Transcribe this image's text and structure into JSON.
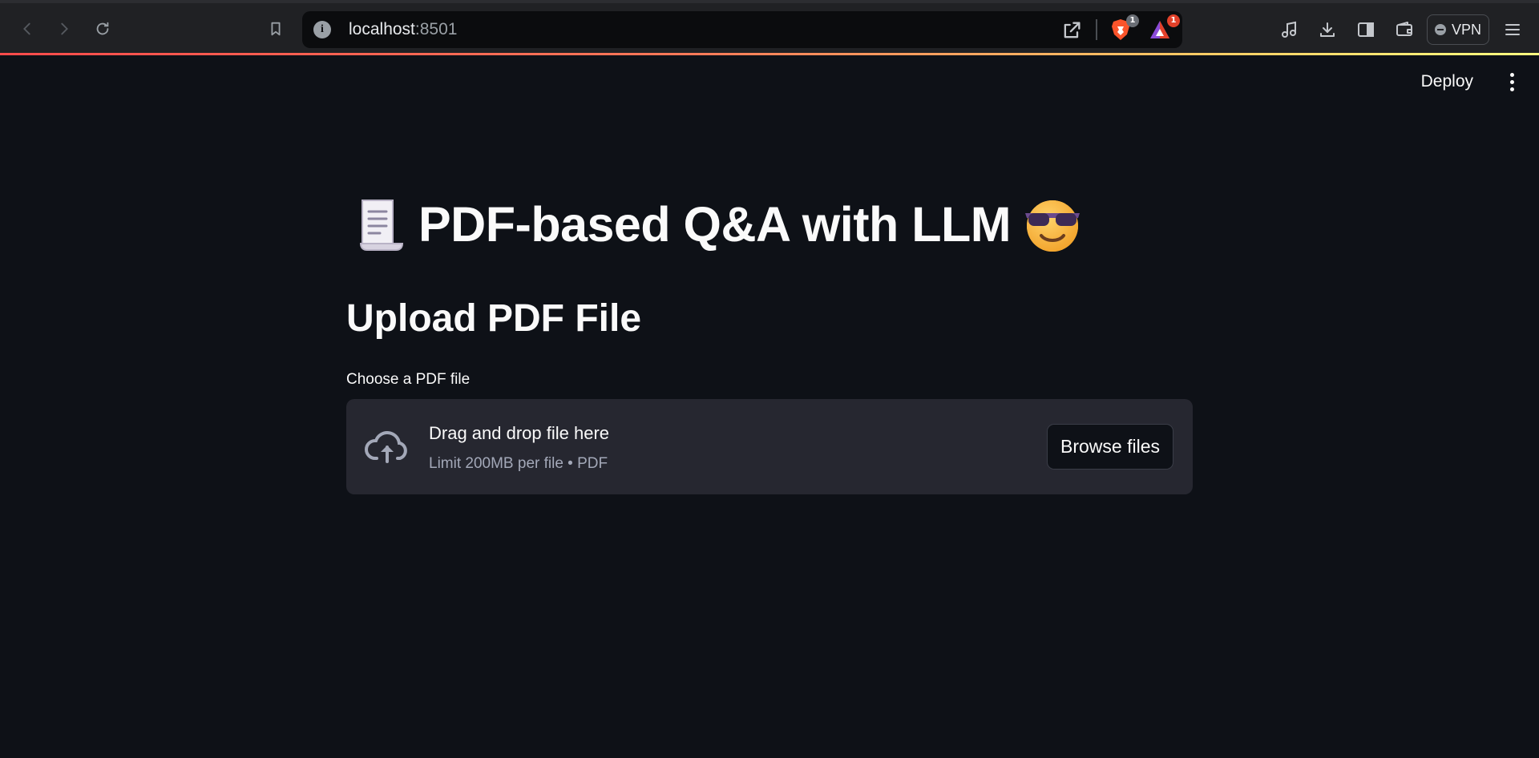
{
  "browser": {
    "url_host": "localhost",
    "url_port": ":8501",
    "brave_badge": "1",
    "rewards_badge": "1",
    "vpn_label": "VPN"
  },
  "app_header": {
    "deploy_label": "Deploy"
  },
  "page": {
    "title": "PDF-based Q&A with LLM",
    "title_prefix_emoji": "page-facing-scroll-icon",
    "title_suffix_emoji": "smiling-face-with-sunglasses-icon",
    "section_heading": "Upload PDF File",
    "uploader": {
      "label": "Choose a PDF file",
      "drop_title": "Drag and drop file here",
      "drop_subtitle": "Limit 200MB per file • PDF",
      "browse_label": "Browse files"
    }
  },
  "colors": {
    "background": "#0e1117",
    "dropzone": "#262730",
    "accent_gradient_start": "#ff4b4b",
    "accent_gradient_end": "#fffd80"
  }
}
